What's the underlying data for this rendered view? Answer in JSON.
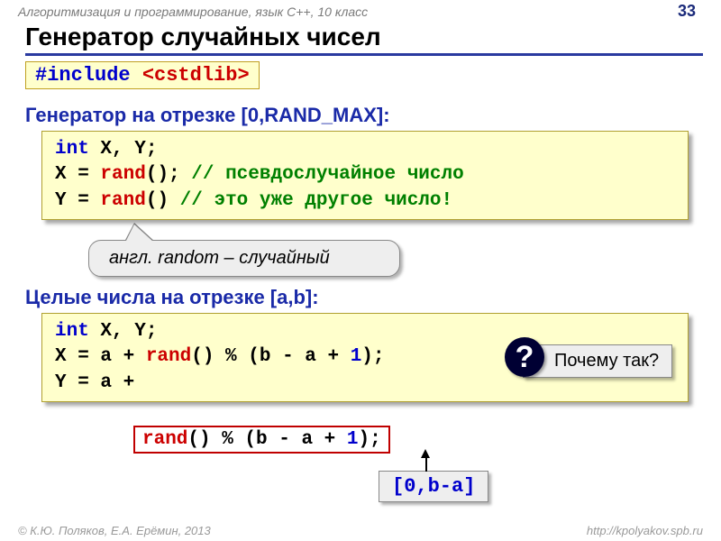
{
  "header": {
    "course": "Алгоритмизация и программирование, язык  C++, 10 класс",
    "page": "33"
  },
  "title": "Генератор случайных чисел",
  "include": {
    "directive": "#include ",
    "header": "<cstdlib>"
  },
  "block1": {
    "heading": "Генератор на отрезке [0,RAND_MAX]:",
    "line1_kw": "int",
    "line1_rest": " X, Y;",
    "line2_pre": "X = ",
    "line2_fn": "rand",
    "line2_post": "(); ",
    "line2_comment": "// псевдослучайное число",
    "line3_pre": "Y = ",
    "line3_fn": "rand",
    "line3_post": "()  ",
    "line3_comment": "// это уже другое число!"
  },
  "callout": {
    "prefix": "англ. ",
    "word": "random",
    "suffix": " – случайный"
  },
  "block2": {
    "heading": "Целые числа на отрезке [a,b]:",
    "line1_kw": "int",
    "line1_rest": " X, Y;",
    "line2_pre": "X = a + ",
    "line2_fn": "rand",
    "line2_mid": "() % (b - a + ",
    "line2_one": "1",
    "line2_end": ");",
    "line3_pre": "Y = a + ",
    "overlay_fn": "rand",
    "overlay_mid": "() % (b - a + ",
    "overlay_one": "1",
    "overlay_end": ");"
  },
  "range_label": "[0,b-a]",
  "question_mark": "?",
  "why_text": "Почему так?",
  "footer": {
    "left": "© К.Ю. Поляков, Е.А. Ерёмин, 2013",
    "right": "http://kpolyakov.spb.ru"
  }
}
